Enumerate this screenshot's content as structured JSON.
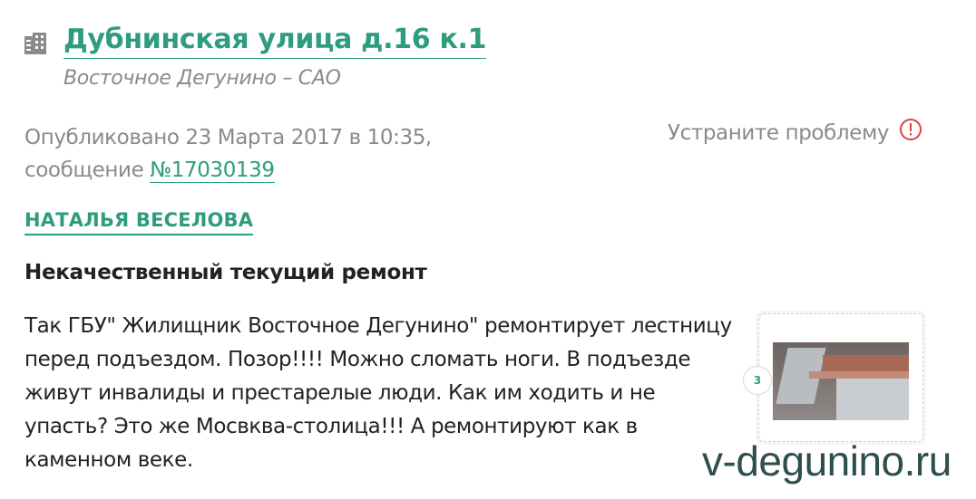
{
  "header": {
    "address": "Дубнинская улица д.16 к.1",
    "district": "Восточное Дегунино – САО"
  },
  "meta": {
    "published": "Опубликовано 23 Марта 2017 в 10:35,",
    "message_prefix": "сообщение",
    "message_number": "№17030139",
    "fix_problem": "Устраните проблему"
  },
  "author": "НАТАЛЬЯ ВЕСЕЛОВА",
  "problem": {
    "title": "Некачественный текущий ремонт",
    "text": "Так ГБУ\" Жилищник Восточное Дегунино\" ремонтирует лестницу перед подъездом. Позор!!!! Можно сломать ноги. В подъезде живут инвалиды и престарелые люди. Как им ходить и не упасть? Это же Мосвква-столица!!! А ремонтируют как в каменном веке."
  },
  "photos": {
    "count": "3"
  },
  "watermark": "v-degunino.ru",
  "colors": {
    "accent": "#2e9c7e",
    "muted": "#8a8a8a",
    "alert": "#e04040"
  },
  "icons": {
    "building": "building-icon",
    "alert": "alert-circle-icon"
  }
}
